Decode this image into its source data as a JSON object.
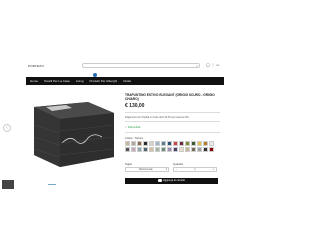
{
  "header": {
    "logo": "PORTEXO",
    "search_placeholder": "",
    "nav": [
      "Home",
      "Tessili Per La Casa",
      "Living",
      "Prodotti Per Alberghi",
      "Outlet"
    ],
    "cart_badge_count": ""
  },
  "product": {
    "title": "TRAPUNTINO ESTIVO ELEGANT (GRIGIO SCURO - GRIGIO CHIARO)",
    "price": "€ 130,00",
    "info": "Pagamenti con PayPal in 3 rate da € 43,33 con interessi 0%.",
    "stock": "✓ Disponibile",
    "color_label": "Colore : Tortora",
    "swatches": [
      "#c9b79a",
      "#b0a8a0",
      "#8a6a4f",
      "#2c2c2c",
      "#d9d2c7",
      "#9fb6c9",
      "#5b7a94",
      "#2f4f6e",
      "#c44",
      "#6a2c3a",
      "#7b8f3a",
      "#3d5a2e",
      "#e1c04a",
      "#b57a2e",
      "#eaeaea",
      "#555",
      "#c8a8b8",
      "#8fa7b3",
      "#4e6270",
      "#d6c0a0",
      "#a3b8a0",
      "#6d8c7a",
      "#9a8fb0",
      "#4b3f6a",
      "#e7dccb",
      "#c2b59b",
      "#7a6a5a",
      "#a0a0a0",
      "#333",
      "#8b0000"
    ],
    "size_label": "Taglia",
    "size_value": "Matrimoniale",
    "qty_label": "Quantità",
    "qty_value": "1",
    "cart_button": "Aggiungi al carrello"
  }
}
